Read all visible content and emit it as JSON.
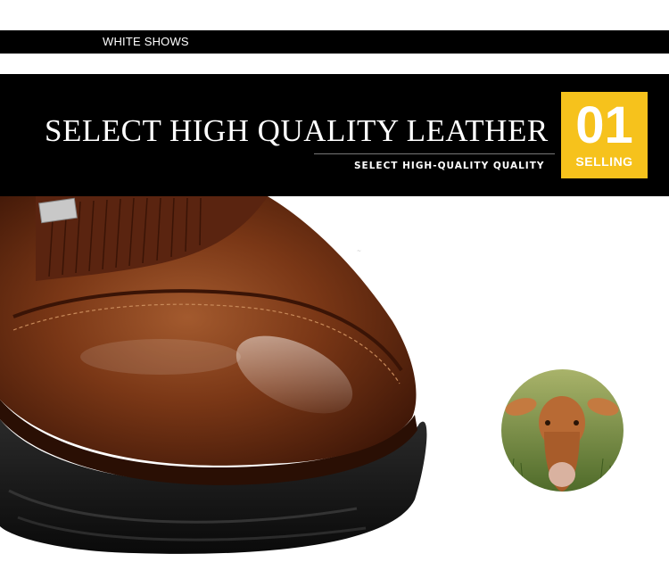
{
  "header": {
    "label": "WHITE SHOWS"
  },
  "banner": {
    "title": "SELECT HIGH QUALITY LEATHER",
    "subtitle": "SELECT HIGH-QUALITY QUALITY",
    "badge_number": "01",
    "badge_label": "SELLING",
    "accent_color": "#f6c21c"
  },
  "images": {
    "product": "brown-leather-shoe-closeup",
    "material": "cow-in-grass-circle"
  },
  "colors": {
    "leather": "#6b2e12",
    "sole": "#1a1a1a",
    "banner": "#000000"
  }
}
